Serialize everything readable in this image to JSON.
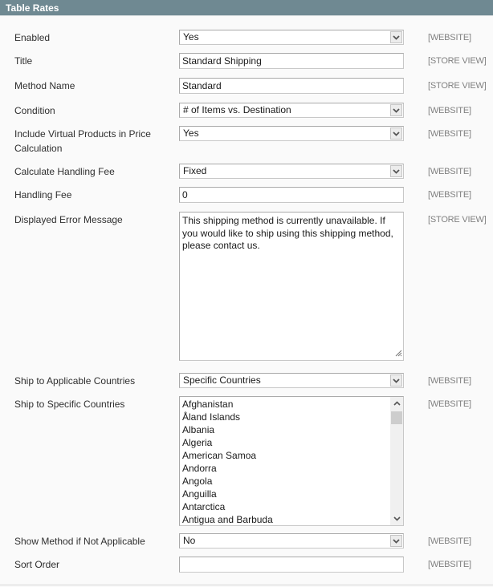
{
  "section": {
    "title": "Table Rates"
  },
  "fields": [
    {
      "label": "Enabled",
      "type": "select",
      "value": "Yes",
      "scope": "[WEBSITE]"
    },
    {
      "label": "Title",
      "type": "input",
      "value": "Standard Shipping",
      "scope": "[STORE VIEW]"
    },
    {
      "label": "Method Name",
      "type": "input",
      "value": "Standard",
      "scope": "[STORE VIEW]"
    },
    {
      "label": "Condition",
      "type": "select",
      "value": "# of Items vs. Destination",
      "scope": "[WEBSITE]"
    },
    {
      "label": "Include Virtual Products in Price Calculation",
      "type": "select",
      "value": "Yes",
      "scope": "[WEBSITE]"
    },
    {
      "label": "Calculate Handling Fee",
      "type": "select",
      "value": "Fixed",
      "scope": "[WEBSITE]"
    },
    {
      "label": "Handling Fee",
      "type": "input",
      "value": "0",
      "scope": "[WEBSITE]"
    },
    {
      "label": "Displayed Error Message",
      "type": "textarea",
      "value": "This shipping method is currently unavailable. If you would like to ship using this shipping method, please contact us.",
      "scope": "[STORE VIEW]"
    },
    {
      "label": "Ship to Applicable Countries",
      "type": "select",
      "value": "Specific Countries",
      "scope": "[WEBSITE]"
    },
    {
      "label": "Ship to Specific Countries",
      "type": "multiselect",
      "options": [
        "Afghanistan",
        "Åland Islands",
        "Albania",
        "Algeria",
        "American Samoa",
        "Andorra",
        "Angola",
        "Anguilla",
        "Antarctica",
        "Antigua and Barbuda"
      ],
      "scope": "[WEBSITE]"
    },
    {
      "label": "Show Method if Not Applicable",
      "type": "select",
      "value": "No",
      "scope": "[WEBSITE]"
    },
    {
      "label": "Sort Order",
      "type": "input",
      "value": "",
      "scope": "[WEBSITE]"
    }
  ],
  "icons": {
    "dropdown": "chevron-down-icon",
    "scroll_up": "chevron-up-icon",
    "scroll_down": "chevron-down-icon",
    "resize": "resize-grip-icon"
  },
  "colors": {
    "header_bg": "#6f8992",
    "page_bg": "#fafafa",
    "scope_text": "#808080"
  }
}
